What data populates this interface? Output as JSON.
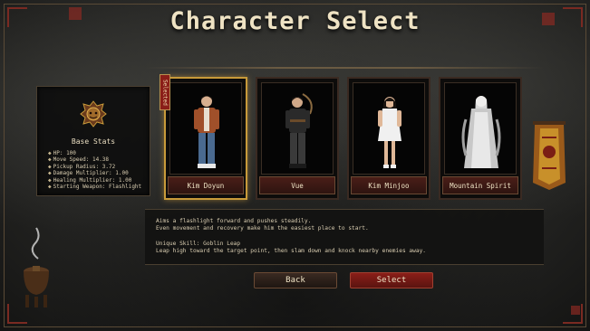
{
  "title": "Character Select",
  "stats": {
    "heading": "Base Stats",
    "items": [
      "HP: 100",
      "Move Speed: 14.38",
      "Pickup Radius: 3.72",
      "Damage Multiplier: 1.00",
      "Healing Multiplier: 1.00",
      "Starting Weapon: Flashlight"
    ]
  },
  "selected_label": "Selected",
  "characters": [
    {
      "name": "Kim Doyun",
      "selected": true
    },
    {
      "name": "Vue",
      "selected": false
    },
    {
      "name": "Kim Minjoo",
      "selected": false
    },
    {
      "name": "Mountain Spirit",
      "selected": false
    }
  ],
  "description": {
    "line1": "Aims a flashlight forward and pushes steadily.",
    "line2": "Even movement and recovery make him the easiest place to start.",
    "skill_title": "Unique Skill: Goblin Leap",
    "skill_desc": "Leap high toward the target point, then slam down and knock nearby enemies away."
  },
  "buttons": {
    "back": "Back",
    "select": "Select"
  },
  "colors": {
    "accent_gold": "#c89a3a",
    "accent_red": "#8a1e18",
    "text": "#e8dcc0"
  }
}
